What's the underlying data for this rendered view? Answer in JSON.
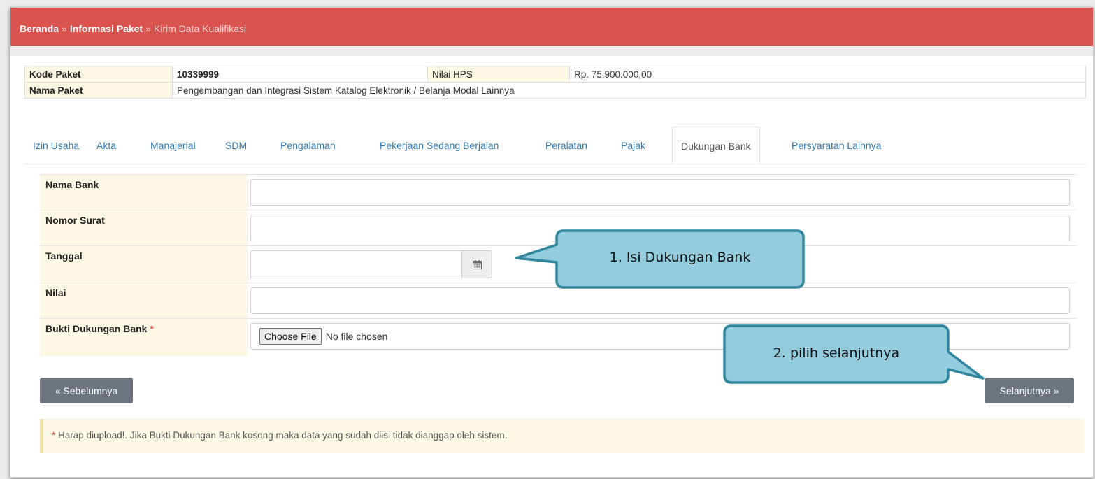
{
  "breadcrumb": {
    "home": "Beranda",
    "separator": "»",
    "package_info": "Informasi Paket",
    "current": "Kirim Data Kualifikasi"
  },
  "package": {
    "code_label": "Kode Paket",
    "code_value": "10339999",
    "hps_label": "Nilai HPS",
    "hps_value": "Rp. 75.900.000,00",
    "name_label": "Nama Paket",
    "name_value": "Pengembangan dan Integrasi Sistem Katalog Elektronik / Belanja Modal Lainnya"
  },
  "tabs": [
    {
      "label": "Izin Usaha",
      "active": false
    },
    {
      "label": "Akta",
      "active": false
    },
    {
      "label": "Manajerial",
      "active": false
    },
    {
      "label": "SDM",
      "active": false
    },
    {
      "label": "Pengalaman",
      "active": false
    },
    {
      "label": "Pekerjaan Sedang Berjalan",
      "active": false
    },
    {
      "label": "Peralatan",
      "active": false
    },
    {
      "label": "Pajak",
      "active": false
    },
    {
      "label": "Dukungan Bank",
      "active": true
    },
    {
      "label": "Persyaratan Lainnya",
      "active": false
    }
  ],
  "form": {
    "bank_name_label": "Nama Bank",
    "letter_number_label": "Nomor Surat",
    "date_label": "Tanggal",
    "value_label": "Nilai",
    "proof_label": "Bukti Dukungan Bank",
    "required_mark": "*",
    "choose_file_label": "Choose File",
    "no_file_text": "No file chosen"
  },
  "buttons": {
    "previous": "« Sebelumnya",
    "next": "Selanjutnya »"
  },
  "note": {
    "mark": "*",
    "text": " Harap diupload!. Jika Bukti Dukungan Bank kosong maka data yang sudah diisi tidak dianggap oleh sistem."
  },
  "callouts": {
    "fill_bank_support": "1. Isi Dukungan Bank",
    "choose_next": "2. pilih selanjutnya"
  },
  "colors": {
    "header_red": "#d9534f",
    "link_blue": "#337ab7",
    "label_cream": "#fcf8e3",
    "button_gray": "#6c757d",
    "callout_fill": "#93cddd",
    "callout_border": "#31859c"
  }
}
